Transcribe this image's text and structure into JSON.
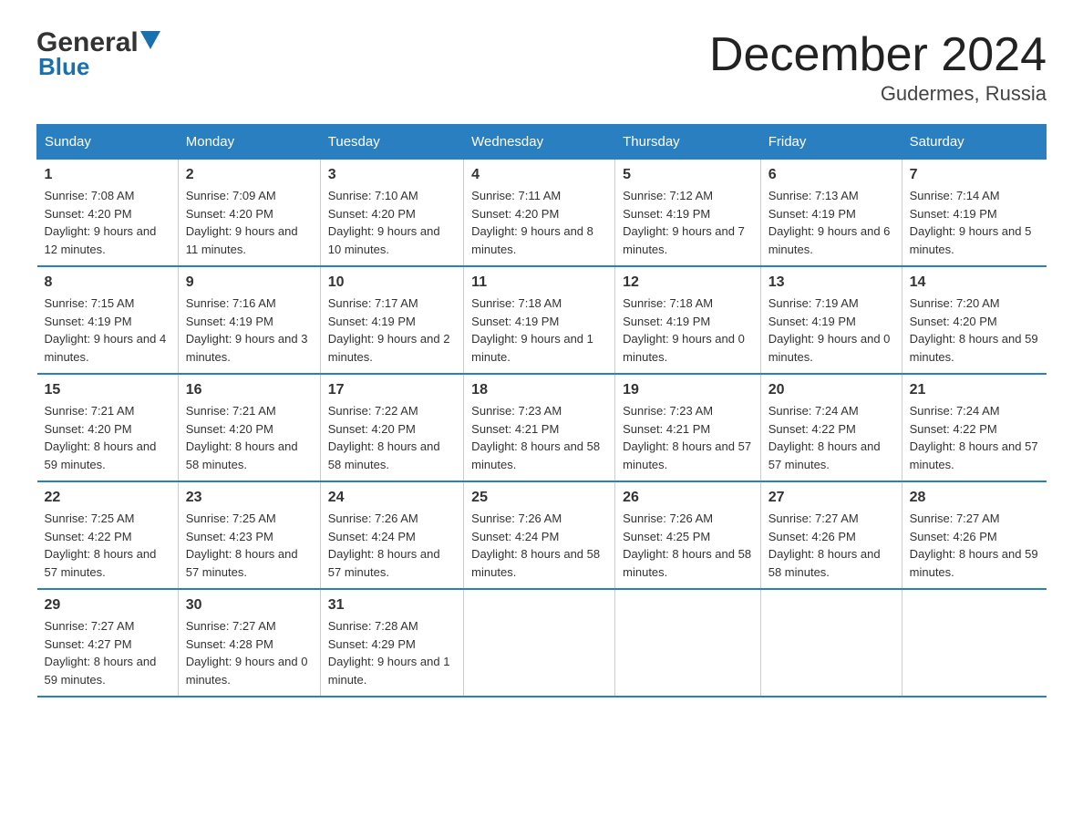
{
  "logo": {
    "general": "General",
    "blue": "Blue"
  },
  "title": "December 2024",
  "subtitle": "Gudermes, Russia",
  "days_of_week": [
    "Sunday",
    "Monday",
    "Tuesday",
    "Wednesday",
    "Thursday",
    "Friday",
    "Saturday"
  ],
  "weeks": [
    [
      {
        "num": "1",
        "sunrise": "7:08 AM",
        "sunset": "4:20 PM",
        "daylight": "9 hours and 12 minutes."
      },
      {
        "num": "2",
        "sunrise": "7:09 AM",
        "sunset": "4:20 PM",
        "daylight": "9 hours and 11 minutes."
      },
      {
        "num": "3",
        "sunrise": "7:10 AM",
        "sunset": "4:20 PM",
        "daylight": "9 hours and 10 minutes."
      },
      {
        "num": "4",
        "sunrise": "7:11 AM",
        "sunset": "4:20 PM",
        "daylight": "9 hours and 8 minutes."
      },
      {
        "num": "5",
        "sunrise": "7:12 AM",
        "sunset": "4:19 PM",
        "daylight": "9 hours and 7 minutes."
      },
      {
        "num": "6",
        "sunrise": "7:13 AM",
        "sunset": "4:19 PM",
        "daylight": "9 hours and 6 minutes."
      },
      {
        "num": "7",
        "sunrise": "7:14 AM",
        "sunset": "4:19 PM",
        "daylight": "9 hours and 5 minutes."
      }
    ],
    [
      {
        "num": "8",
        "sunrise": "7:15 AM",
        "sunset": "4:19 PM",
        "daylight": "9 hours and 4 minutes."
      },
      {
        "num": "9",
        "sunrise": "7:16 AM",
        "sunset": "4:19 PM",
        "daylight": "9 hours and 3 minutes."
      },
      {
        "num": "10",
        "sunrise": "7:17 AM",
        "sunset": "4:19 PM",
        "daylight": "9 hours and 2 minutes."
      },
      {
        "num": "11",
        "sunrise": "7:18 AM",
        "sunset": "4:19 PM",
        "daylight": "9 hours and 1 minute."
      },
      {
        "num": "12",
        "sunrise": "7:18 AM",
        "sunset": "4:19 PM",
        "daylight": "9 hours and 0 minutes."
      },
      {
        "num": "13",
        "sunrise": "7:19 AM",
        "sunset": "4:19 PM",
        "daylight": "9 hours and 0 minutes."
      },
      {
        "num": "14",
        "sunrise": "7:20 AM",
        "sunset": "4:20 PM",
        "daylight": "8 hours and 59 minutes."
      }
    ],
    [
      {
        "num": "15",
        "sunrise": "7:21 AM",
        "sunset": "4:20 PM",
        "daylight": "8 hours and 59 minutes."
      },
      {
        "num": "16",
        "sunrise": "7:21 AM",
        "sunset": "4:20 PM",
        "daylight": "8 hours and 58 minutes."
      },
      {
        "num": "17",
        "sunrise": "7:22 AM",
        "sunset": "4:20 PM",
        "daylight": "8 hours and 58 minutes."
      },
      {
        "num": "18",
        "sunrise": "7:23 AM",
        "sunset": "4:21 PM",
        "daylight": "8 hours and 58 minutes."
      },
      {
        "num": "19",
        "sunrise": "7:23 AM",
        "sunset": "4:21 PM",
        "daylight": "8 hours and 57 minutes."
      },
      {
        "num": "20",
        "sunrise": "7:24 AM",
        "sunset": "4:22 PM",
        "daylight": "8 hours and 57 minutes."
      },
      {
        "num": "21",
        "sunrise": "7:24 AM",
        "sunset": "4:22 PM",
        "daylight": "8 hours and 57 minutes."
      }
    ],
    [
      {
        "num": "22",
        "sunrise": "7:25 AM",
        "sunset": "4:22 PM",
        "daylight": "8 hours and 57 minutes."
      },
      {
        "num": "23",
        "sunrise": "7:25 AM",
        "sunset": "4:23 PM",
        "daylight": "8 hours and 57 minutes."
      },
      {
        "num": "24",
        "sunrise": "7:26 AM",
        "sunset": "4:24 PM",
        "daylight": "8 hours and 57 minutes."
      },
      {
        "num": "25",
        "sunrise": "7:26 AM",
        "sunset": "4:24 PM",
        "daylight": "8 hours and 58 minutes."
      },
      {
        "num": "26",
        "sunrise": "7:26 AM",
        "sunset": "4:25 PM",
        "daylight": "8 hours and 58 minutes."
      },
      {
        "num": "27",
        "sunrise": "7:27 AM",
        "sunset": "4:26 PM",
        "daylight": "8 hours and 58 minutes."
      },
      {
        "num": "28",
        "sunrise": "7:27 AM",
        "sunset": "4:26 PM",
        "daylight": "8 hours and 59 minutes."
      }
    ],
    [
      {
        "num": "29",
        "sunrise": "7:27 AM",
        "sunset": "4:27 PM",
        "daylight": "8 hours and 59 minutes."
      },
      {
        "num": "30",
        "sunrise": "7:27 AM",
        "sunset": "4:28 PM",
        "daylight": "9 hours and 0 minutes."
      },
      {
        "num": "31",
        "sunrise": "7:28 AM",
        "sunset": "4:29 PM",
        "daylight": "9 hours and 1 minute."
      },
      null,
      null,
      null,
      null
    ]
  ]
}
